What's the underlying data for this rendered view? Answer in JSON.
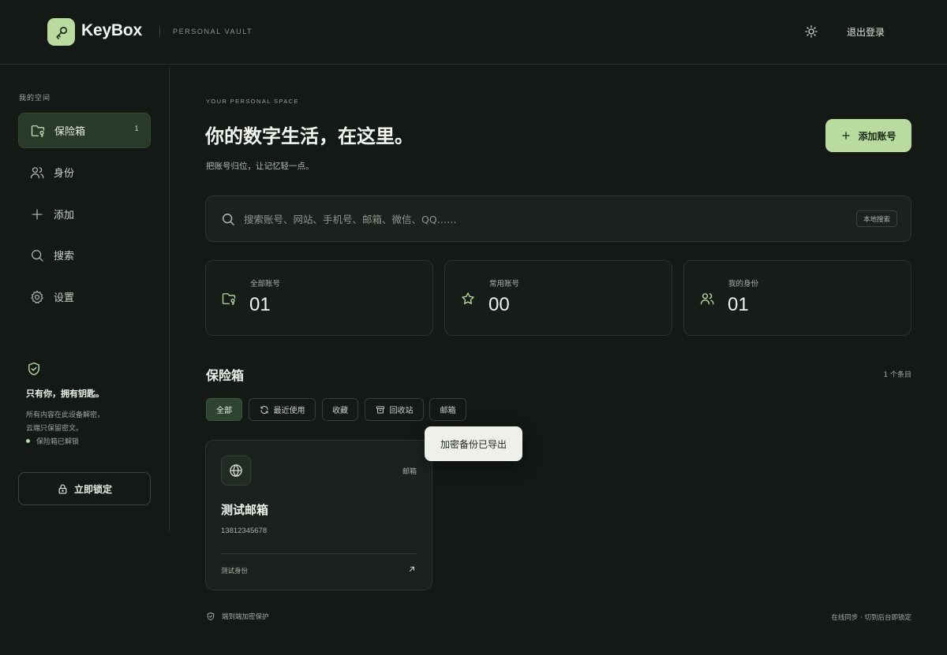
{
  "brand": {
    "name": "KeyBox",
    "subtitle": "PERSONAL VAULT"
  },
  "header": {
    "logout_label": "退出登录",
    "theme_icon": "sun-icon"
  },
  "sidebar": {
    "title": "我的空间",
    "items": [
      {
        "label": "保险箱",
        "count": "1",
        "icon": "folder-key-icon"
      },
      {
        "label": "身份",
        "icon": "users-icon"
      },
      {
        "label": "添加",
        "icon": "plus-icon"
      },
      {
        "label": "搜索",
        "icon": "search-icon"
      },
      {
        "label": "设置",
        "icon": "gear-icon"
      }
    ],
    "note": {
      "title": "只有你，拥有钥匙。",
      "line1": "所有内容在此设备解密，",
      "line2": "云端只保留密文。",
      "status": "保险箱已解锁"
    },
    "lock_label": "立即锁定"
  },
  "main": {
    "eyebrow": "YOUR PERSONAL SPACE",
    "title": "你的数字生活，在这里。",
    "subtitle": "把账号归位，让记忆轻一点。",
    "add_label": "添加账号",
    "search": {
      "placeholder": "搜索账号、网站、手机号、邮箱、微信、QQ……",
      "tag": "本地搜索"
    },
    "stats": [
      {
        "label": "全部账号",
        "value": "01",
        "icon": "folder-key-icon"
      },
      {
        "label": "常用账号",
        "value": "00",
        "icon": "star-icon"
      },
      {
        "label": "我的身份",
        "value": "01",
        "icon": "users-icon"
      }
    ],
    "section": {
      "title": "保险箱",
      "count": "1 个条目"
    },
    "filters": [
      {
        "label": "全部"
      },
      {
        "label": "最近使用",
        "icon": "refresh-icon"
      },
      {
        "label": "收藏"
      },
      {
        "label": "回收站",
        "icon": "archive-icon"
      },
      {
        "label": "邮箱"
      }
    ],
    "toast": "加密备份已导出",
    "card": {
      "type": "邮箱",
      "title": "测试邮箱",
      "phone": "13812345678",
      "identity": "测试身份",
      "icon": "globe-icon"
    },
    "footer": {
      "left": "端到端加密保护",
      "right": "在线同步 · 切到后台即锁定"
    }
  },
  "colors": {
    "accent": "#b9dba0",
    "background": "#141915",
    "active_nav": "#2a3a29"
  }
}
